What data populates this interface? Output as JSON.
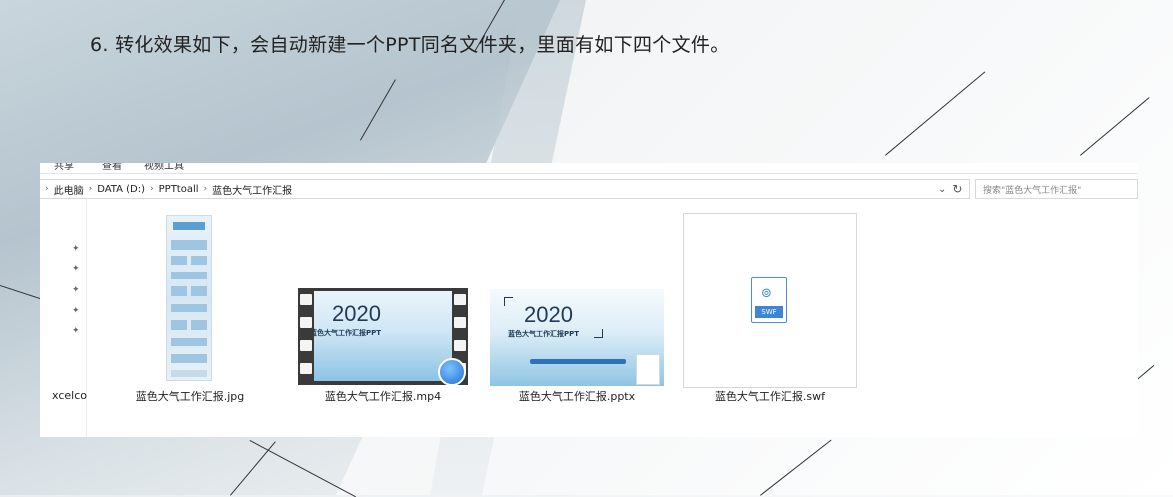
{
  "caption": "6. 转化效果如下，会自动新建一个PPT同名文件夹，里面有如下四个文件。",
  "explorer": {
    "ribbon": {
      "tabs": [
        "共享",
        "查看",
        "视频工具"
      ]
    },
    "breadcrumb": [
      "此电脑",
      "DATA (D:)",
      "PPTtoall",
      "蓝色大气工作汇报"
    ],
    "search_placeholder": "搜索\"蓝色大气工作汇报\"",
    "nav_label": "xcelco",
    "files": [
      {
        "name": "蓝色大气工作汇报.jpg",
        "type": "jpg"
      },
      {
        "name": "蓝色大气工作汇报.mp4",
        "type": "mp4"
      },
      {
        "name": "蓝色大气工作汇报.pptx",
        "type": "pptx"
      },
      {
        "name": "蓝色大气工作汇报.swf",
        "type": "swf"
      }
    ],
    "thumbnails": {
      "year": "2020",
      "title": "蓝色大气工作汇报PPT"
    },
    "swf_label": "SWF"
  },
  "colors": {
    "accent": "#3d86d4",
    "window_bg": "#ffffff"
  }
}
